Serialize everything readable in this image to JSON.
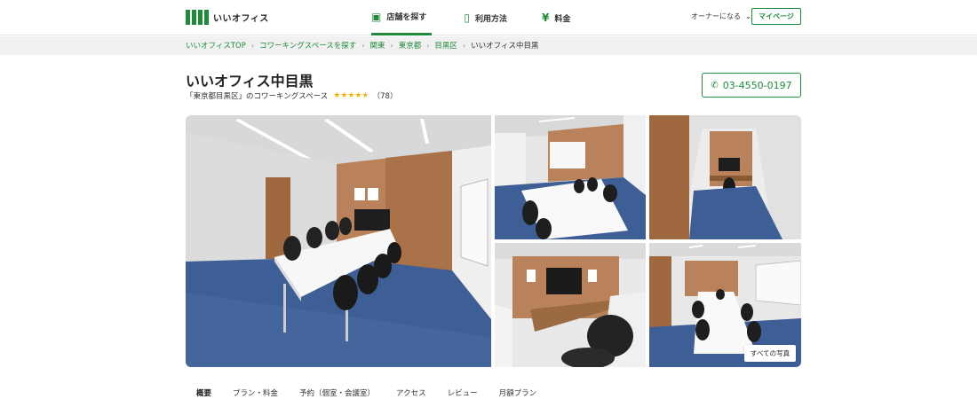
{
  "header": {
    "logo_text": "いいオフィス",
    "nav": [
      {
        "label": "店舗を探す",
        "icon": "map-search-icon"
      },
      {
        "label": "利用方法",
        "icon": "smartphone-icon"
      },
      {
        "label": "料金",
        "icon": "yen-icon"
      }
    ],
    "owner_label": "オーナーになる",
    "mypage_label": "マイページ"
  },
  "breadcrumb": {
    "items": [
      "いいオフィスTOP",
      "コワーキングスペースを探す",
      "関東",
      "東京都",
      "目黒区"
    ],
    "current": "いいオフィス中目黒"
  },
  "space": {
    "title": "いいオフィス中目黒",
    "subtitle": "「東京都目黒区」のコワーキングスペース",
    "rating": 4.5,
    "review_count": "（78）",
    "phone": "03-4550-0197"
  },
  "gallery": {
    "all_photos_label": "すべての写真"
  },
  "tabs": [
    "概要",
    "プラン・料金",
    "予約（個室・会議室）",
    "アクセス",
    "レビュー",
    "月額プラン"
  ],
  "colors": {
    "brand_green": "#1e8c3a",
    "star": "#f4b400",
    "carpet": "#3d5f96",
    "wood": "#b9825a"
  }
}
